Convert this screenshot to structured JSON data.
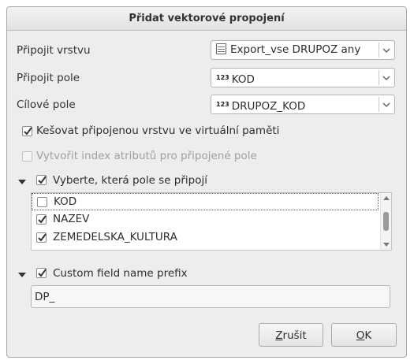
{
  "dialog": {
    "title": "Přidat vektorové propojení"
  },
  "join_layer": {
    "label": "Připojit vrstvu",
    "value": "Export_vse DRUPOZ any",
    "icon": "table-icon"
  },
  "join_field": {
    "label": "Připojit pole",
    "value": "KOD",
    "type_icon": "123"
  },
  "target_field": {
    "label": "Cílové pole",
    "value": "DRUPOZ_KOD",
    "type_icon": "123"
  },
  "cache": {
    "label": "Kešovat připojenou vrstvu ve virtuální paměti",
    "checked": true
  },
  "index": {
    "label": "Vytvořit index atributů pro připojené pole",
    "checked": false,
    "disabled": true
  },
  "fields_group": {
    "label": "Vyberte, která pole se připojí",
    "checked": true,
    "items": [
      {
        "label": "KOD",
        "checked": false
      },
      {
        "label": "NAZEV",
        "checked": true
      },
      {
        "label": "ZEMEDELSKA_KULTURA",
        "checked": true
      }
    ]
  },
  "prefix_group": {
    "label": "Custom field name prefix",
    "checked": true,
    "value": "DP_"
  },
  "buttons": {
    "cancel_mnemonic": "Z",
    "cancel_rest": "rušit",
    "ok_mnemonic": "O",
    "ok_rest": "K"
  }
}
